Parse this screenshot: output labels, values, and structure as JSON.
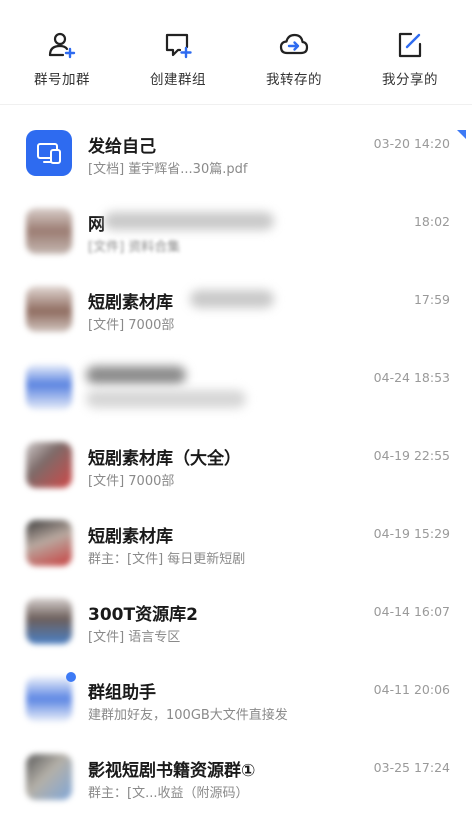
{
  "top_actions": [
    {
      "label": "群号加群",
      "icon": "add-user-icon"
    },
    {
      "label": "创建群组",
      "icon": "create-group-icon"
    },
    {
      "label": "我转存的",
      "icon": "cloud-transfer-icon"
    },
    {
      "label": "我分享的",
      "icon": "share-edit-icon"
    }
  ],
  "accent_color": "#2e6bf0",
  "chats": [
    {
      "title": "发给自己",
      "subtitle": "[文档] 董宇辉省...30篇.pdf",
      "time": "03-20 14:20",
      "pinned": true
    },
    {
      "title": "网",
      "subtitle": "[文件] 资料合集",
      "time": "18:02"
    },
    {
      "title": "短剧素材库",
      "subtitle": "[文件] 7000部",
      "time": "17:59"
    },
    {
      "title": "",
      "subtitle": "",
      "time": "04-24 18:53"
    },
    {
      "title": "短剧素材库（大全）",
      "subtitle": "[文件] 7000部",
      "time": "04-19 22:55"
    },
    {
      "title": "短剧素材库",
      "subtitle": "群主：[文件] 每日更新短剧",
      "time": "04-19 15:29"
    },
    {
      "title": "300T资源库2",
      "subtitle": "[文件] 语言专区",
      "time": "04-14 16:07"
    },
    {
      "title": "群组助手",
      "subtitle": "建群加好友，100GB大文件直接发",
      "time": "04-11 20:06"
    },
    {
      "title": "影视短剧书籍资源群①",
      "subtitle": "群主：[文...收益（附源码）",
      "time": "03-25 17:24"
    }
  ]
}
